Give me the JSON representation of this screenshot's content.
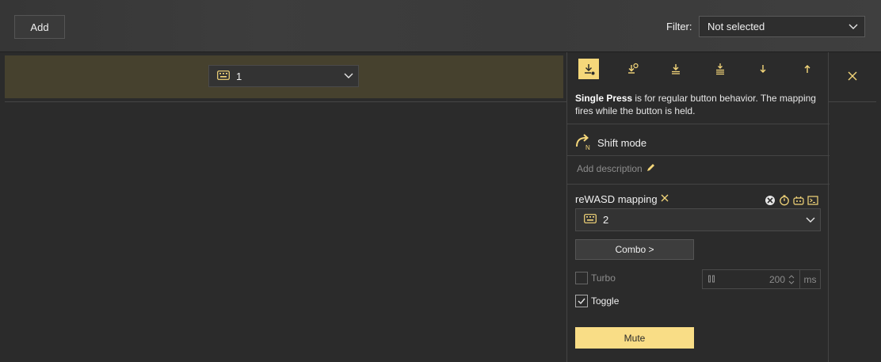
{
  "toolbar": {
    "add_label": "Add",
    "filter_label": "Filter:",
    "filter_value": "Not selected"
  },
  "row": {
    "select_value": "1"
  },
  "panel": {
    "modes": [
      "single-press-icon",
      "long-press-icon",
      "double-press-icon",
      "triple-press-icon",
      "start-press-icon",
      "release-icon"
    ],
    "desc_bold": "Single Press",
    "desc_text": " is for regular button behavior. The mapping fires while the button is held.",
    "shift_label": "Shift mode",
    "add_description": "Add description",
    "mapping_label": "reWASD mapping",
    "mapping_value": "2",
    "combo_label": "Combo >",
    "turbo_label": "Turbo",
    "turbo_value": "200",
    "turbo_unit": "ms",
    "toggle_label": "Toggle",
    "mute_label": "Mute",
    "accent": "#f5d77a"
  }
}
